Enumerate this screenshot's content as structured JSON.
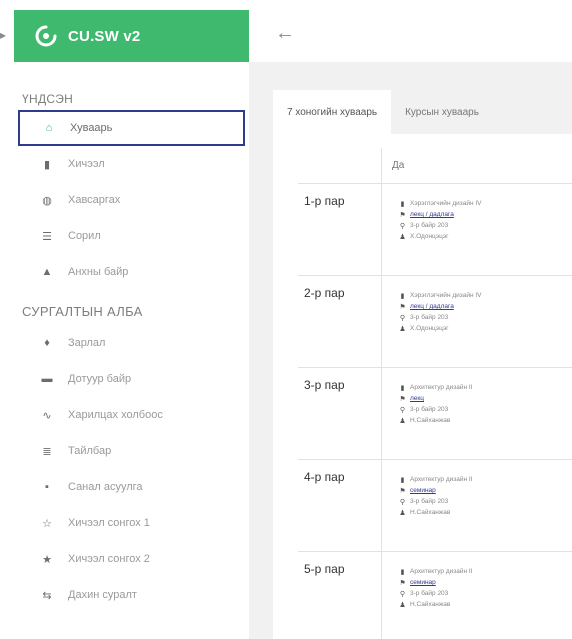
{
  "brand": {
    "title": "CU.SW v2"
  },
  "sidebar": {
    "section1": "ҮНДСЭН",
    "section2": "СУРГАЛТЫН АЛБА",
    "items1": [
      {
        "label": "Хуваарь",
        "icon": "home-icon",
        "glyph": "⌂"
      },
      {
        "label": "Хичээл",
        "icon": "book-icon",
        "glyph": "▮"
      },
      {
        "label": "Хавсаргах",
        "icon": "globe-icon",
        "glyph": "◍"
      },
      {
        "label": "Сорил",
        "icon": "list-icon",
        "glyph": "☰"
      },
      {
        "label": "Анхны байр",
        "icon": "building-icon",
        "glyph": "▲"
      }
    ],
    "items2": [
      {
        "label": "Зарлал",
        "icon": "bell-icon",
        "glyph": "♦"
      },
      {
        "label": "Дотуур байр",
        "icon": "bed-icon",
        "glyph": "▬"
      },
      {
        "label": "Харилцах холбоос",
        "icon": "link-icon",
        "glyph": "∿"
      },
      {
        "label": "Тайлбар",
        "icon": "table-icon",
        "glyph": "≣"
      },
      {
        "label": "Санал асуулга",
        "icon": "chat-icon",
        "glyph": "▪"
      },
      {
        "label": "Хичээл сонгох 1",
        "icon": "star-outline-icon",
        "glyph": "☆"
      },
      {
        "label": "Хичээл сонгох 2",
        "icon": "star-icon",
        "glyph": "★"
      },
      {
        "label": "Дахин суралт",
        "icon": "exchange-icon",
        "glyph": "⇆"
      }
    ]
  },
  "main": {
    "tabs": [
      "7 хоногийн хуваарь",
      "Курсын хуваарь"
    ],
    "day_header": "Да",
    "rows": [
      {
        "label": "1-р пар",
        "course": "Хэрэглэгчийн дизайн IV",
        "type": "лекц / дадлага",
        "room": "3-р байр 203",
        "teacher": "Х.Одонцэцэг"
      },
      {
        "label": "2-р пар",
        "course": "Хэрэглэгчийн дизайн IV",
        "type": "лекц / дадлага",
        "room": "3-р байр 203",
        "teacher": "Х.Одонцэцэг"
      },
      {
        "label": "3-р пар",
        "course": "Архитектур дизайн II",
        "type": "лекц",
        "room": "3-р байр 203",
        "teacher": "Н.Сайханжав"
      },
      {
        "label": "4-р пар",
        "course": "Архитектур дизайн II",
        "type": "семинар",
        "room": "3-р байр 203",
        "teacher": "Н.Сайханжав"
      },
      {
        "label": "5-р пар",
        "course": "Архитектур дизайн II",
        "type": "семинар",
        "room": "3-р байр 203",
        "teacher": "Н.Сайханжав"
      }
    ]
  },
  "colors": {
    "brand": "#3fb96e",
    "active_border": "#2f3b8f",
    "main_bg": "#f1f1f1"
  }
}
